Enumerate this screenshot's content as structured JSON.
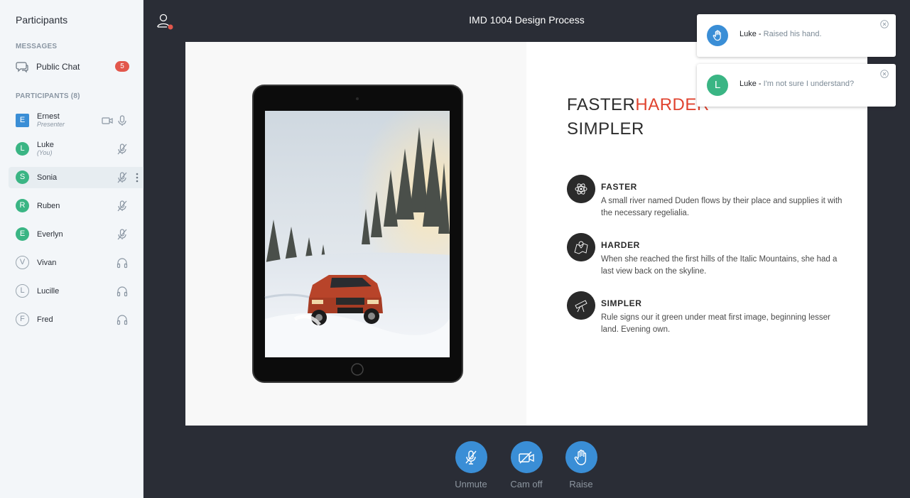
{
  "sidebar": {
    "title": "Participants",
    "messages_header": "MESSAGES",
    "public_chat": {
      "label": "Public Chat",
      "badge": "5"
    },
    "participants_header": "PARTICIPANTS (8)",
    "participants": [
      {
        "initial": "E",
        "name": "Ernest",
        "subtitle": "Presenter",
        "avatar": "square",
        "color": "#3a8ed6",
        "icons": [
          "video-icon",
          "mic-icon"
        ]
      },
      {
        "initial": "L",
        "name": "Luke",
        "subtitle": "(You)",
        "avatar": "circle",
        "color": "#3ab584",
        "icons": [
          "mic-muted-icon"
        ]
      },
      {
        "initial": "S",
        "name": "Sonia",
        "subtitle": "",
        "avatar": "circle",
        "color": "#3ab584",
        "icons": [
          "mic-muted-icon"
        ],
        "highlighted": true
      },
      {
        "initial": "R",
        "name": "Ruben",
        "subtitle": "",
        "avatar": "circle",
        "color": "#3ab584",
        "icons": [
          "mic-muted-icon"
        ]
      },
      {
        "initial": "E",
        "name": "Everlyn",
        "subtitle": "",
        "avatar": "circle",
        "color": "#3ab584",
        "icons": [
          "mic-muted-icon"
        ]
      },
      {
        "initial": "V",
        "name": "Vivan",
        "subtitle": "",
        "avatar": "outline",
        "icons": [
          "headphones-icon"
        ]
      },
      {
        "initial": "L",
        "name": "Lucille",
        "subtitle": "",
        "avatar": "outline",
        "icons": [
          "headphones-icon"
        ]
      },
      {
        "initial": "F",
        "name": "Fred",
        "subtitle": "",
        "avatar": "outline",
        "icons": [
          "headphones-icon"
        ]
      }
    ]
  },
  "header": {
    "title": "IMD 1004 Design Process"
  },
  "slide": {
    "heading_part1": "FASTER",
    "heading_part2": "HARDER",
    "heading_line2": "SIMPLER",
    "features": [
      {
        "icon": "atom-icon",
        "title": "FASTER",
        "text": "A small river named Duden flows by their place and supplies it with the necessary regelialia."
      },
      {
        "icon": "map-icon",
        "title": "HARDER",
        "text": "When she reached the first hills of the Italic Mountains, she had a last view back on the skyline."
      },
      {
        "icon": "telescope-icon",
        "title": "SIMPLER",
        "text": "Rule signs our it green under meat first image, beginning lesser land. Evening own."
      }
    ]
  },
  "notifications": [
    {
      "avatar": "hand-icon",
      "name": "Luke -",
      "message": "Raised his hand."
    },
    {
      "avatar": "L",
      "name": "Luke -",
      "message": "I'm not sure I understand?"
    }
  ],
  "controls": {
    "unmute": "Unmute",
    "cam_off": "Cam off",
    "raise": "Raise"
  },
  "colors": {
    "accent": "#3a8ed6",
    "avatar_green": "#3ab584",
    "badge_red": "#e2574c",
    "slide_red": "#e0432f",
    "main_bg": "#2a2d36"
  }
}
